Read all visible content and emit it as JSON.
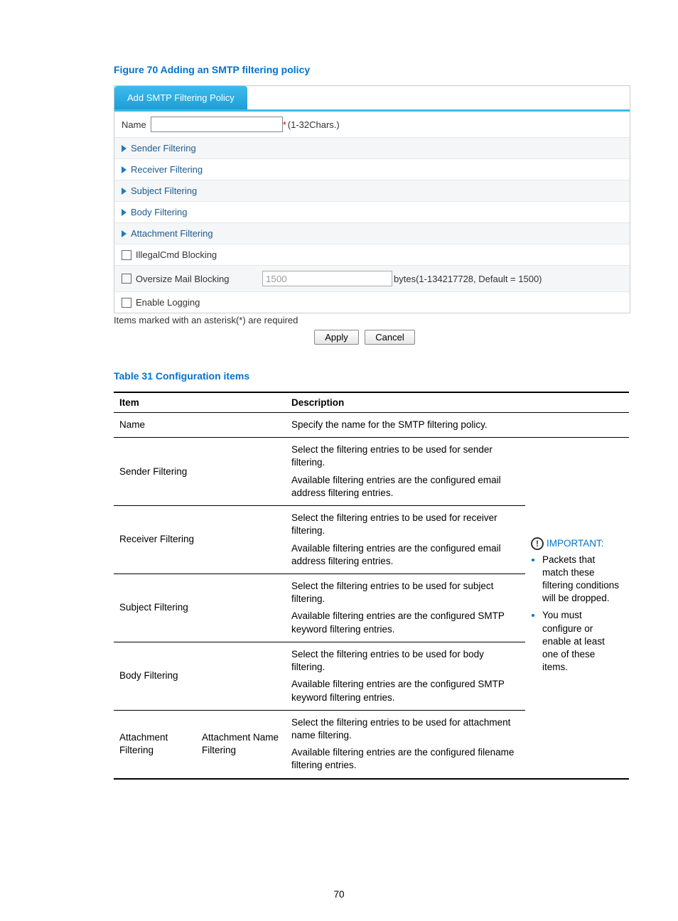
{
  "figure_caption": "Figure 70 Adding an SMTP filtering policy",
  "form": {
    "tab_label": "Add SMTP Filtering Policy",
    "name_label": "Name",
    "name_hint_prefix": "*",
    "name_hint": "(1-32Chars.)",
    "rows": {
      "sender": "Sender Filtering",
      "receiver": "Receiver Filtering",
      "subject": "Subject Filtering",
      "body": "Body Filtering",
      "attachment": "Attachment Filtering",
      "illegal_cmd": "IllegalCmd Blocking",
      "oversize": "Oversize Mail Blocking",
      "oversize_value": "1500",
      "oversize_hint": "bytes(1-134217728, Default = 1500)",
      "logging": "Enable Logging"
    },
    "footnote": "Items marked with an asterisk(*) are required",
    "apply": "Apply",
    "cancel": "Cancel"
  },
  "table_caption": "Table 31 Configuration items",
  "table": {
    "head_item": "Item",
    "head_desc": "Description",
    "name": {
      "item": "Name",
      "desc": "Specify the name for the SMTP filtering policy."
    },
    "sender": {
      "item": "Sender Filtering",
      "d1": "Select the filtering entries to be used for sender filtering.",
      "d2": "Available filtering entries are the configured email address filtering entries."
    },
    "receiver": {
      "item": "Receiver Filtering",
      "d1": "Select the filtering entries to be used for receiver filtering.",
      "d2": "Available filtering entries are the configured email address filtering entries."
    },
    "subject": {
      "item": "Subject Filtering",
      "d1": "Select the filtering entries to be used for subject filtering.",
      "d2": "Available filtering entries are the configured SMTP keyword filtering entries."
    },
    "body": {
      "item": "Body Filtering",
      "d1": "Select the filtering entries to be used for body filtering.",
      "d2": "Available filtering entries are the configured SMTP keyword filtering entries."
    },
    "attach": {
      "item1": "Attachment Filtering",
      "item2": "Attachment Name Filtering",
      "d1": "Select the filtering entries to be used for attachment name filtering.",
      "d2": "Available filtering entries are the configured filename filtering entries."
    },
    "important": {
      "title": "IMPORTANT:",
      "b1": "Packets that match these filtering conditions will be dropped.",
      "b2": "You must configure or enable at least one of these items."
    }
  },
  "page_number": "70"
}
